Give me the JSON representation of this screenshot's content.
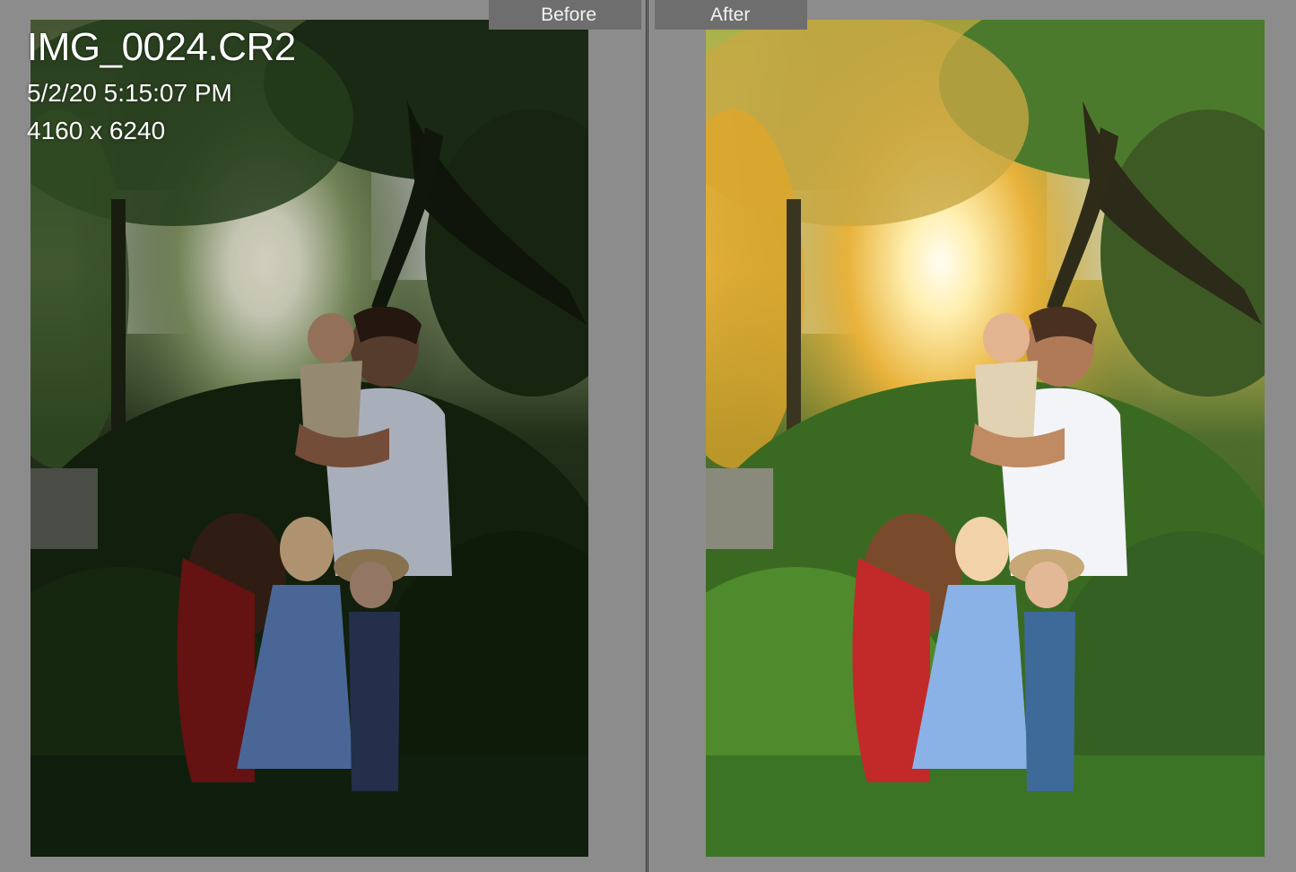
{
  "labels": {
    "before": "Before",
    "after": "After"
  },
  "photo_info": {
    "filename": "IMG_0024.CR2",
    "datetime": "5/2/20 5:15:07 PM",
    "dimensions": "4160 x 6240"
  },
  "colors": {
    "background": "#8c8c8c",
    "label_bar": "#6e6e6e",
    "label_text": "#f2f2f2",
    "overlay_text": "#ffffff"
  },
  "icons": {
    "before_photo": "family-portrait-dark-edit",
    "after_photo": "family-portrait-warm-edit"
  }
}
